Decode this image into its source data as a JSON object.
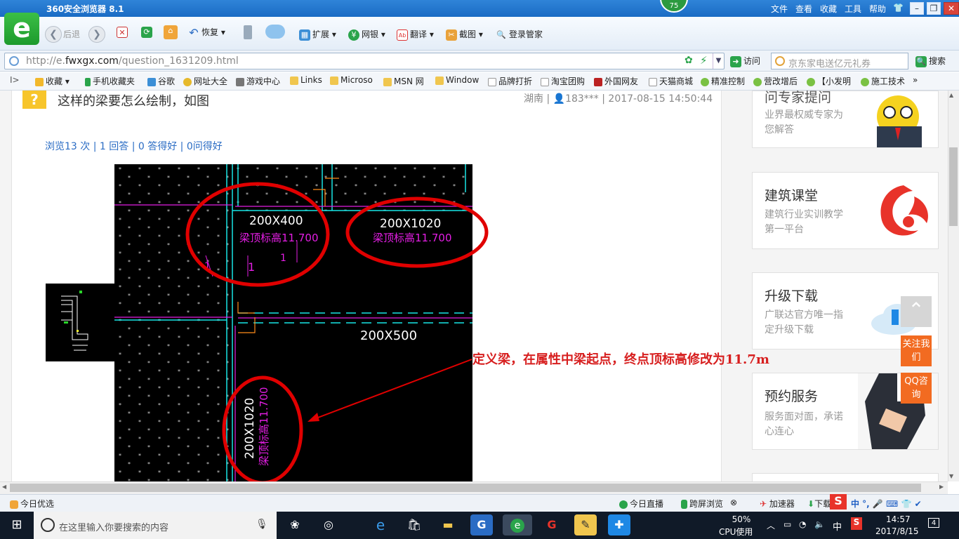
{
  "window": {
    "title": "360安全浏览器 8.1",
    "badge": "75",
    "menu": [
      "文件",
      "查看",
      "收藏",
      "工具",
      "帮助"
    ]
  },
  "toolbar": {
    "back_label": "后退",
    "restore_label": "恢复",
    "extend_label": "扩展",
    "bank_label": "网银",
    "translate_label": "翻译",
    "screenshot_label": "截图",
    "login_label": "登录管家"
  },
  "address": {
    "url_prefix": "http://e.",
    "url_domain": "fwxgx.com",
    "url_path": "/question_1631209.html",
    "go_label": "访问",
    "search_placeholder": "京东家电送亿元礼券",
    "search_label": "搜索"
  },
  "bookmarks": {
    "items": [
      "收藏",
      "手机收藏夹",
      "谷歌",
      "网址大全",
      "游戏中心",
      "Links",
      "Microso",
      "MSN 网",
      "Window",
      "品牌打折",
      "淘宝团购",
      "外国网友",
      "天猫商城",
      "精准控制",
      "营改增后",
      "【小发明",
      "施工技术"
    ],
    "more": "»"
  },
  "question": {
    "mark": "?",
    "title": "这样的梁要怎么绘制，如图",
    "region": "湖南",
    "user": "183***",
    "datetime": "2017-08-15 14:50:44",
    "stats": "浏览13 次 | 1 回答 | 0 答得好 | 0问得好"
  },
  "cad": {
    "label_1": "200X400",
    "label_1_sub": "梁顶标高11.700",
    "label_2": "200X1020",
    "label_2_sub": "梁顶标高11.700",
    "label_3": "200X500",
    "label_4": "200X1020",
    "label_4_sub": "梁顶标高11.700",
    "mark_1": "1",
    "mark_2": "1",
    "mark_3": "1"
  },
  "annotation": "定义梁，在属性中梁起点，终点顶标高修改为11.7m",
  "sidebar": {
    "cards": [
      {
        "title": "问专家提问",
        "desc": "业界最权威专家为您解答"
      },
      {
        "title": "建筑课堂",
        "desc": "建筑行业实训教学第一平台"
      },
      {
        "title": "升级下载",
        "desc": "广联达官方唯一指定升级下载"
      },
      {
        "title": "预约服务",
        "desc": "服务面对面，承诺心连心"
      }
    ],
    "follow_label": "关注我们",
    "qq_label": "QQ咨询"
  },
  "status": {
    "left": "今日优选",
    "live": "今日直播",
    "cross_screen": "跨屏浏览",
    "accelerator": "加速器",
    "download": "下载"
  },
  "taskbar": {
    "search_placeholder": "在这里输入你要搜索的内容",
    "cpu_percent": "50%",
    "cpu_label": "CPU使用",
    "ime": "中",
    "time": "14:57",
    "date": "2017/8/15",
    "notifications": "4"
  },
  "colors": {
    "cad_cyan": "#19e5e5",
    "cad_magenta": "#e41ee4",
    "cad_white": "#ffffff",
    "circle_red": "#e00000",
    "accent_orange": "#f26b21",
    "link_blue": "#2a6cc4"
  }
}
